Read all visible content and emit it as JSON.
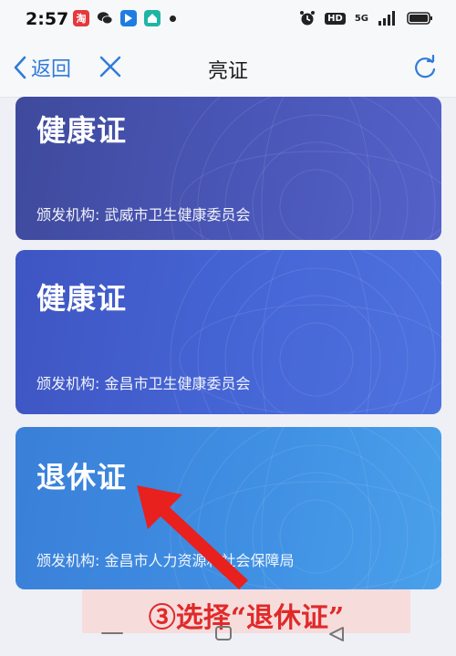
{
  "status_bar": {
    "time": "2:57",
    "network": "5G",
    "hd": "HD"
  },
  "nav": {
    "back_label": "返回",
    "title": "亮证"
  },
  "cards": [
    {
      "title": "健康证",
      "issuer": "颁发机构: 武威市卫生健康委员会"
    },
    {
      "title": "健康证",
      "issuer": "颁发机构: 金昌市卫生健康委员会"
    },
    {
      "title": "退休证",
      "issuer": "颁发机构: 金昌市人力资源和社会保障局"
    }
  ],
  "annotation": {
    "instruction": "③选择“退休证”",
    "arrow_color": "#e8201e",
    "banner_color": "#f7dcdc"
  },
  "colors": {
    "accent": "#2f7bd9",
    "card1": "#4a57b8",
    "card2": "#4666d6",
    "card3": "#3f8fe3"
  },
  "icons": [
    "chevron-left-icon",
    "close-icon",
    "refresh-icon",
    "alarm-icon",
    "signal-icon",
    "battery-icon",
    "wechat-icon",
    "taobao-icon"
  ]
}
